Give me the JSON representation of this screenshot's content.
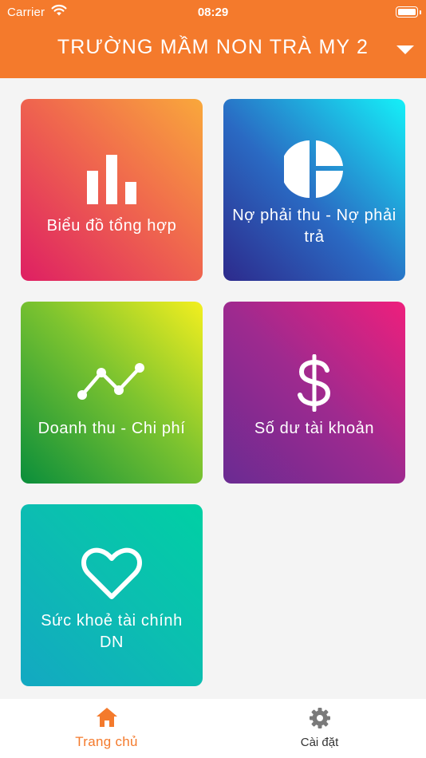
{
  "status_bar": {
    "carrier": "Carrier",
    "time": "08:29"
  },
  "header": {
    "title": "TRƯỜNG MẦM NON TRÀ MY 2"
  },
  "colors": {
    "header": "#f47a2c",
    "active_tab": "#f47a2c",
    "inactive_tab_icon": "#7a7a7a",
    "background": "#f4f4f4"
  },
  "tiles": [
    {
      "label": "Biểu đồ tổng hợp",
      "icon": "bar-chart-icon"
    },
    {
      "label": "Nợ phải thu - Nợ phải trả",
      "icon": "pie-chart-icon"
    },
    {
      "label": "Doanh thu - Chi phí",
      "icon": "line-chart-icon"
    },
    {
      "label": "Số dư tài khoản",
      "icon": "dollar-icon"
    },
    {
      "label": "Sức khoẻ tài chính DN",
      "icon": "heart-icon"
    }
  ],
  "tabbar": {
    "home": {
      "label": "Trang chủ",
      "icon": "home-icon",
      "active": true
    },
    "settings": {
      "label": "Cài đặt",
      "icon": "gear-icon",
      "active": false
    }
  }
}
